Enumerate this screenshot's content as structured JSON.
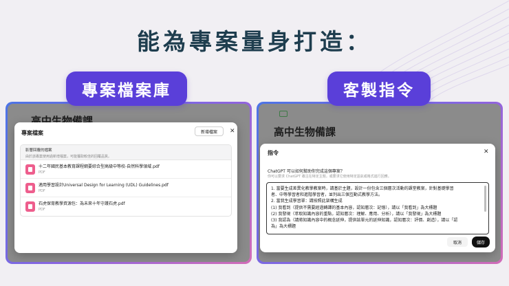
{
  "headline": "能為專案量身打造：",
  "left_card": {
    "pill_label": "專案檔案庫",
    "background_title": "高中生物備課",
    "modal": {
      "title": "專案檔案",
      "new_file_label": "新增檔案",
      "close_glyph": "✕",
      "upload_section": {
        "title": "影響回覆的檔案",
        "hint": "由於該專案使用過新增檔案，可能獲取較佳的回覆品質。"
      },
      "files": [
        {
          "name": "十二年國民基本教育課程綱要綜合型高級中等校-自然科學領域.pdf",
          "type": "PDF"
        },
        {
          "name": "適用學習設計Universal Design for Learning (UDL) Guidelines.pdf",
          "type": "PDF"
        },
        {
          "name": "石虎保育教學資源包：為未來十年守護石虎.pdf",
          "type": "PDF"
        }
      ]
    }
  },
  "right_card": {
    "pill_label": "客製指令",
    "background_title": "高中生物備課",
    "modal": {
      "title": "指令",
      "close_glyph": "✕",
      "question": "ChatGPT 可以如何幫助你完成這個專案？",
      "hint": "你可以要求 ChatGPT 專注在特定主題，或要求它使用特定語氣或格式進行回應。",
      "instruction_lines": [
        "1. 當要生成差異化教學教案時，請基於主題，設計一份包含三個層次活動的課堂教案，針對基礎學習",
        "者、中等學習者和進階學習者，並列出三個互動式教學方法。",
        "2. 當我生成學習單：請按照此架構生成",
        "(1) 我看到（提供不需要經過轉譯的基本內容，認知層次：記憶），請以「我看到」為大標題",
        "(2) 我發現（萃取知識內容的重點，認知層次：理解、應用、分析），請以「我發現」為大標題",
        "(3) 我認為（請將知識內容中的概念延伸，提供該單元的延伸知識，認知層次：評價、創造），請以「認",
        "為」為大標題"
      ],
      "cancel_label": "取消",
      "save_label": "儲存"
    }
  },
  "colors": {
    "headline": "#1e3d4e",
    "pill": "#5a3fd9",
    "pdf_icon": "#ee5e8d",
    "border_gradient_start": "#4c74e6",
    "border_gradient_end": "#d26cb7"
  }
}
